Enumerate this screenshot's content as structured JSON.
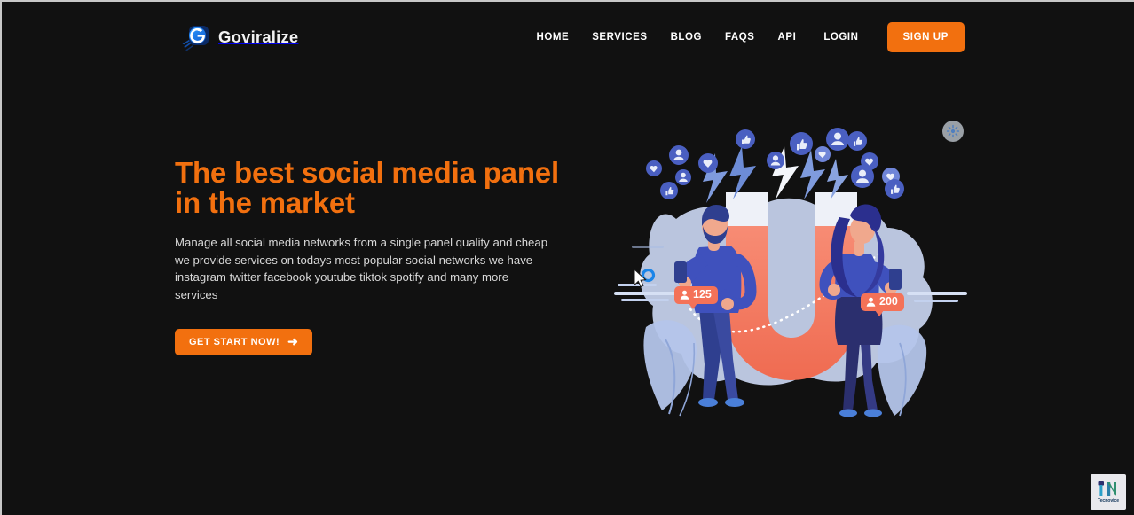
{
  "page": {
    "background_color": "#111111",
    "accent_color": "#f2700f",
    "text_color": "#d8d8d8"
  },
  "header": {
    "brand": {
      "name": "Goviralize",
      "logo_icon": "g-swoosh-logo-icon",
      "logo_color": "#1c7ff2"
    },
    "nav_items": [
      {
        "label": "HOME",
        "name": "nav-home"
      },
      {
        "label": "SERVICES",
        "name": "nav-services"
      },
      {
        "label": "BLOG",
        "name": "nav-blog"
      },
      {
        "label": "FAQS",
        "name": "nav-faqs"
      },
      {
        "label": "API",
        "name": "nav-api"
      },
      {
        "label": "LOGIN",
        "name": "nav-login"
      }
    ],
    "signup_label": "SIGN UP",
    "signup_color": "#f2700f"
  },
  "hero": {
    "title_line_1": "The best social media panel",
    "title_line_2": "in the market",
    "title_color": "#f2700f",
    "subtitle": "Manage all social media networks from a single panel quality and cheap we provide services on todays most popular social networks we have instagram twitter facebook youtube tiktok spotify and many more services",
    "cta_label": "GET START NOW!",
    "cta_arrow_icon": "arrow-right-icon"
  },
  "illustration": {
    "name": "social-media-magnet-illustration",
    "magnet_color": "#f4836c",
    "blob_color": "#c5d2ef",
    "badges": [
      {
        "value": "125",
        "icon": "person-icon",
        "color": "#f47258"
      },
      {
        "value": "200",
        "icon": "person-icon",
        "color": "#f47258"
      }
    ],
    "reaction_icons": [
      "heart-icon",
      "thumbs-up-icon",
      "person-icon"
    ]
  },
  "overlays": {
    "loader_chip_icon": "loading-spinner-icon",
    "cursor_icon": "pointer-busy-cursor-icon",
    "watermark_label": "Tecnovice",
    "watermark_icon": "tn-monogram-icon"
  }
}
